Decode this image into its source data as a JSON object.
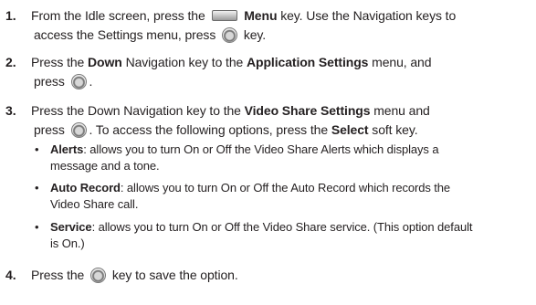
{
  "steps": [
    {
      "number": "1.",
      "line1": {
        "a": "From the Idle screen, press the",
        "b_bold": "Menu",
        "c": "key. Use the Navigation keys to"
      },
      "line2": {
        "a": "access the Settings menu, press",
        "b": "key."
      }
    },
    {
      "number": "2.",
      "line1": {
        "a": "Press the",
        "b_bold": "Down",
        "c": "Navigation key to the",
        "d_bold": "Application Settings",
        "e": "menu, and"
      },
      "line2": {
        "a": "press",
        "b": "."
      }
    },
    {
      "number": "3.",
      "line1": {
        "a": "Press the Down Navigation key to the",
        "b_bold": "Video Share Settings",
        "c": "menu and"
      },
      "line2": {
        "a": "press",
        "b": ". To access the following options, press the",
        "c_bold": "Select",
        "d": "soft key."
      },
      "options": [
        {
          "term": "Alerts",
          "line1": ": allows you to turn On or Off the Video Share Alerts which displays a",
          "line2": "message and a tone."
        },
        {
          "term": "Auto Record",
          "line1": ": allows you to turn On or Off the Auto Record which records the",
          "line2": "Video Share call."
        },
        {
          "term": "Service",
          "line1": ": allows you to turn On or Off the Video Share service. (This option default",
          "line2": "is On.)"
        }
      ]
    },
    {
      "number": "4.",
      "line1": {
        "a": "Press the",
        "b": "key to save the option."
      }
    }
  ],
  "icons": {
    "menu_key": "menu-soft-key-icon",
    "ok_key": "ok-center-key-icon"
  }
}
